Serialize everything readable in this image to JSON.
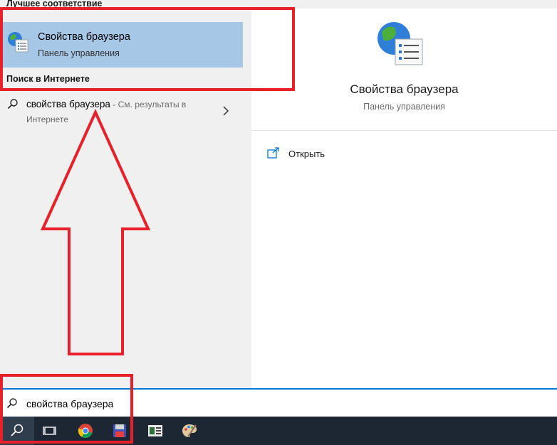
{
  "left_pane": {
    "best_match_heading": "Лучшее соответствие",
    "best_match": {
      "title": "Свойства браузера",
      "subtitle": "Панель управления",
      "icon": "internet-options-icon"
    },
    "web_heading": "Поиск в Интернете",
    "web_result": {
      "query": "свойства браузера",
      "hint": " - См. результаты в",
      "hint_line2": "Интернете"
    }
  },
  "right_pane": {
    "title": "Свойства браузера",
    "subtitle": "Панель управления",
    "actions": [
      {
        "label": "Открыть",
        "icon": "open-icon"
      }
    ]
  },
  "search_box": {
    "value": "свойства браузера"
  },
  "taskbar": {
    "items": [
      "search-icon",
      "task-view-icon",
      "chrome-icon",
      "save-app-icon",
      "terminal-app-icon",
      "paint-icon"
    ]
  },
  "colors": {
    "accent": "#0078d7",
    "highlight": "#a7c7e7",
    "annotation": "#e8202a",
    "taskbar": "#1c2733"
  }
}
